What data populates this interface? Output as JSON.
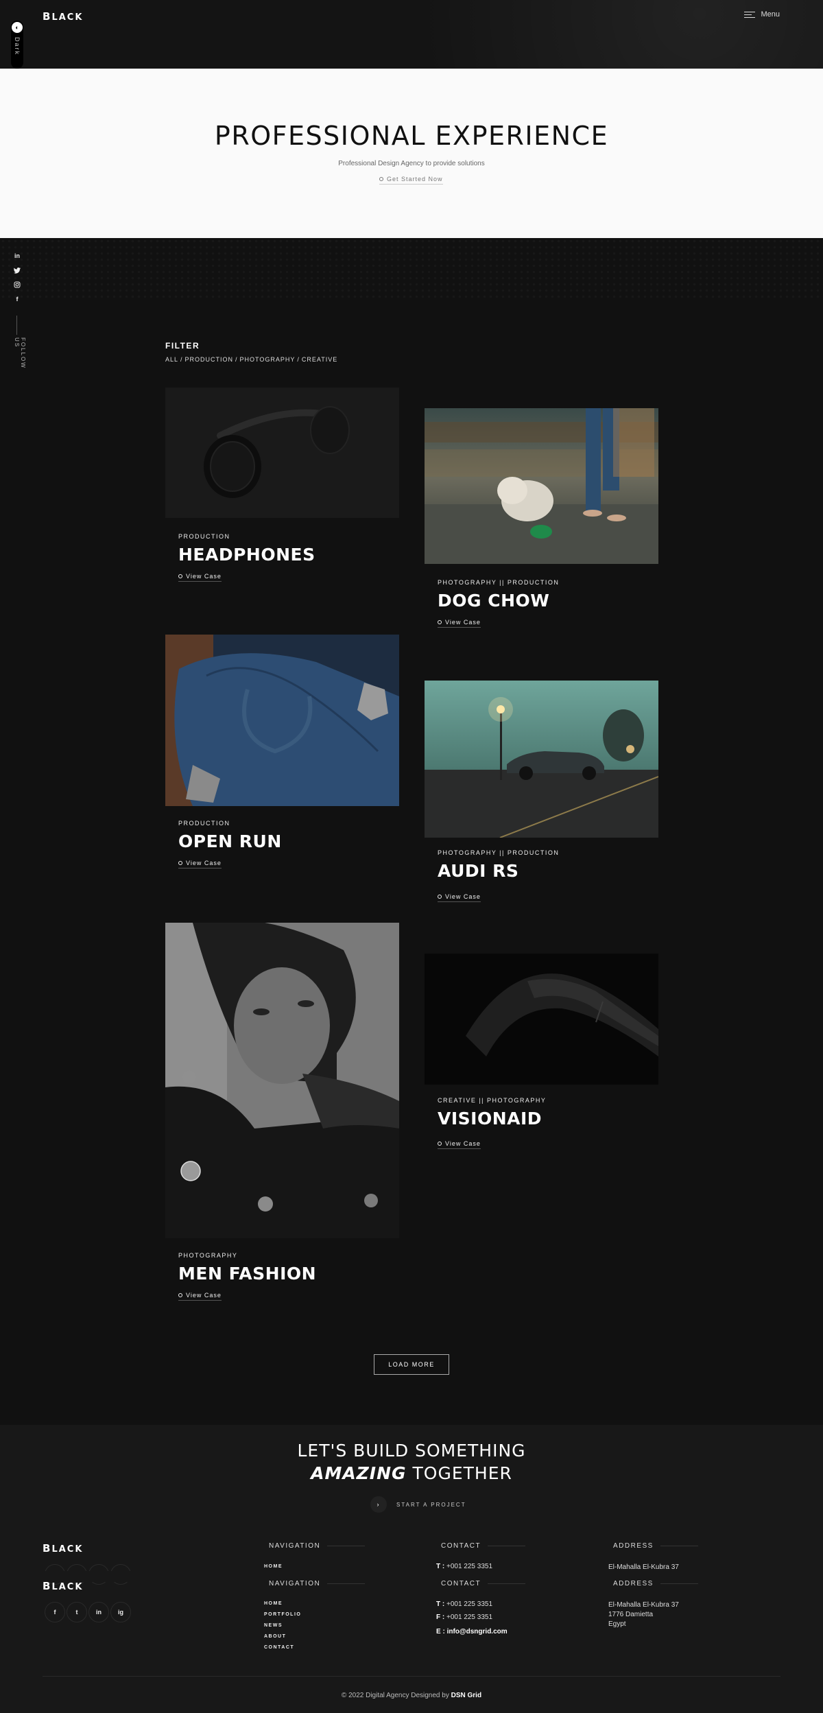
{
  "header": {
    "logo_mark": "B",
    "logo_rest": "LACK",
    "menu_label": "Menu",
    "dark_toggle_label": "Dark"
  },
  "hero": {
    "title": "PROFESSIONAL EXPERIENCE",
    "subtitle": "Professional Design Agency to provide solutions",
    "cta": "Get Started Now"
  },
  "social": {
    "items": [
      "in",
      "t",
      "ig",
      "f"
    ],
    "follow_label": "FOLLOW US"
  },
  "filter": {
    "title": "FILTER",
    "items": [
      "ALL",
      "PRODUCTION",
      "PHOTOGRAPHY",
      "CREATIVE"
    ],
    "separator": "/"
  },
  "projects": [
    {
      "category": "PRODUCTION",
      "title": "HEADPHONES",
      "link": "View Case"
    },
    {
      "category": "PHOTOGRAPHY || PRODUCTION",
      "title": "DOG CHOW",
      "link": "View Case"
    },
    {
      "category": "PRODUCTION",
      "title": "OPEN RUN",
      "link": "View Case"
    },
    {
      "category": "PHOTOGRAPHY || PRODUCTION",
      "title": "AUDI RS",
      "link": "View Case"
    },
    {
      "category": "PHOTOGRAPHY",
      "title": "MEN FASHION",
      "link": "View Case"
    },
    {
      "category": "CREATIVE || PHOTOGRAPHY",
      "title": "VISIONAID",
      "link": "View Case"
    }
  ],
  "load_more": "LOAD MORE",
  "cta_block": {
    "line1": "LET'S BUILD SOMETHING",
    "line2_em": "AMAZING",
    "line2_rest": " TOGETHER",
    "start_label": "START A PROJECT"
  },
  "footer": {
    "navigation_title": "NAVIGATION",
    "navigation_links": [
      "HOME",
      "PORTFOLIO",
      "NEWS",
      "ABOUT",
      "CONTACT"
    ],
    "contact_title": "CONTACT",
    "phone_label": "T :",
    "phone": "+001 225 3351",
    "fax_label": "F :",
    "fax": "+001 225 3351",
    "email_label": "E :",
    "email": "info@dsngrid.com",
    "address_title": "ADDRESS",
    "address_line1": "El-Mahalla El-Kubra 37",
    "address_line2": "1776 Damietta",
    "address_line3": "Egypt",
    "social": [
      "f",
      "t",
      "in",
      "ig"
    ],
    "copyright_text": "© 2022 Digital Agency Designed by ",
    "copyright_brand": "DSN Grid"
  }
}
